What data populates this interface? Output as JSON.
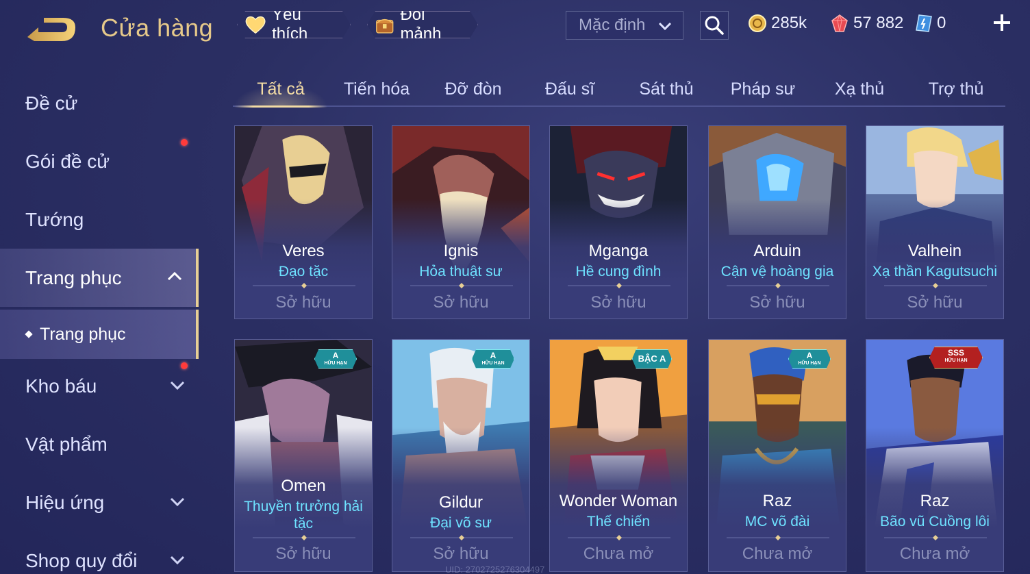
{
  "header": {
    "title": "Cửa hàng",
    "favorites_label": "Yêu thích",
    "exchange_label": "Đổi mảnh",
    "sort": {
      "selected": "Mặc định"
    },
    "currencies": {
      "gold": "285k",
      "ruby": "57 882",
      "voucher": "0"
    }
  },
  "sidebar": {
    "items": [
      {
        "label": "Đề cử"
      },
      {
        "label": "Gói đề cử"
      },
      {
        "label": "Tướng"
      },
      {
        "label": "Trang phục"
      },
      {
        "label": "Trang phục"
      },
      {
        "label": "Kho báu"
      },
      {
        "label": "Vật phẩm"
      },
      {
        "label": "Hiệu ứng"
      },
      {
        "label": "Shop quy đổi"
      }
    ]
  },
  "tabs": [
    "Tất cả",
    "Tiến hóa",
    "Đỡ đòn",
    "Đấu sĩ",
    "Sát thủ",
    "Pháp sư",
    "Xạ thủ",
    "Trợ thủ"
  ],
  "cards": [
    {
      "hero": "Veres",
      "skin": "Đạo tặc",
      "status": "Sở hữu",
      "badge": ""
    },
    {
      "hero": "Ignis",
      "skin": "Hỏa thuật sư",
      "status": "Sở hữu",
      "badge": ""
    },
    {
      "hero": "Mganga",
      "skin": "Hề cung đình",
      "status": "Sở hữu",
      "badge": ""
    },
    {
      "hero": "Arduin",
      "skin": "Cận vệ hoàng gia",
      "status": "Sở hữu",
      "badge": ""
    },
    {
      "hero": "Valhein",
      "skin": "Xạ thần Kagutsuchi",
      "status": "Sở hữu",
      "badge": ""
    },
    {
      "hero": "Omen",
      "skin": "Thuyền trưởng hải tặc",
      "status": "Sở hữu",
      "badge": "A",
      "badge_sub": "HỮU HẠN"
    },
    {
      "hero": "Gildur",
      "skin": "Đại võ sư",
      "status": "Sở hữu",
      "badge": "A",
      "badge_sub": "HỮU HẠN"
    },
    {
      "hero": "Wonder Woman",
      "skin": "Thế chiến",
      "status": "Chưa mở",
      "badge": "BẬC A"
    },
    {
      "hero": "Raz",
      "skin": "MC võ đài",
      "status": "Chưa mở",
      "badge": "A",
      "badge_sub": "HỮU HẠN"
    },
    {
      "hero": "Raz",
      "skin": "Bão vũ Cuồng lôi",
      "status": "Chưa mở",
      "badge": "SSS",
      "badge_sub": "HỮU HẠN"
    }
  ],
  "footer": {
    "uid": "UID: 2702725276304497"
  },
  "colors": {
    "accent_gold": "#e6c98a",
    "skin_cyan": "#6ee2ff",
    "status_gray": "#8a8fb8",
    "background": "#2b2f63"
  }
}
